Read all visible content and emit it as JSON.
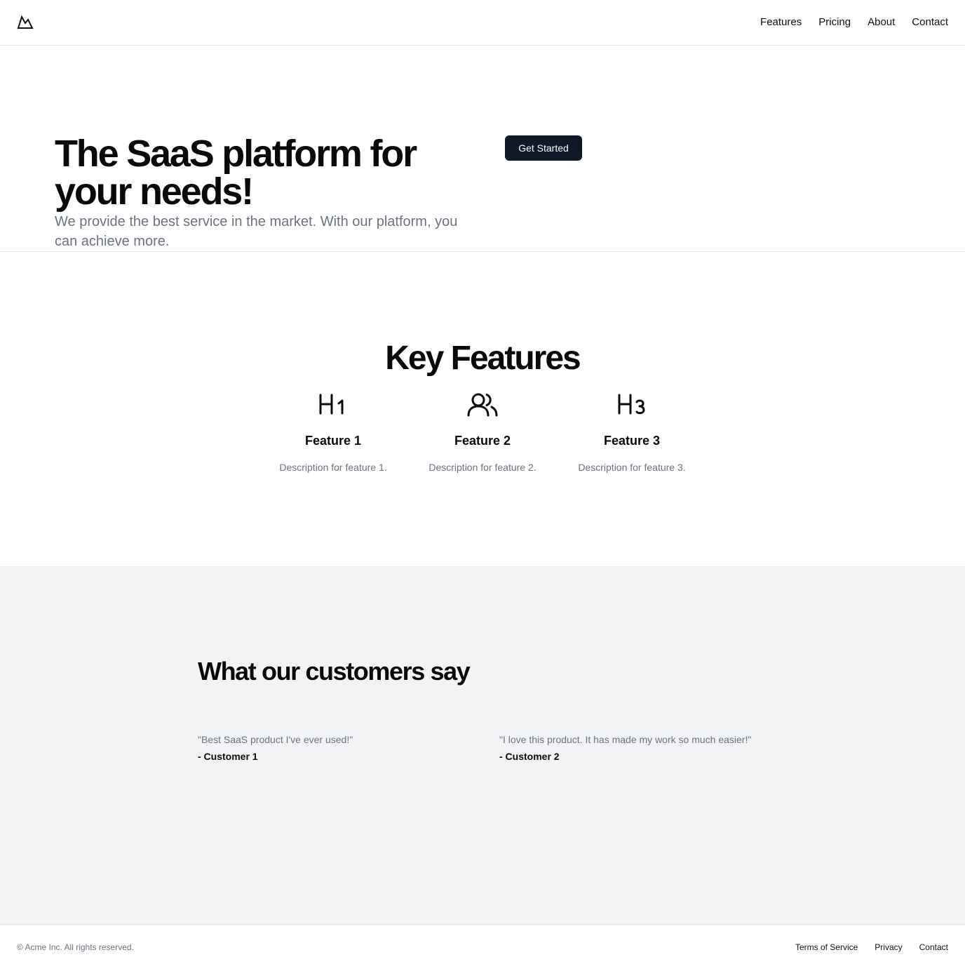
{
  "header": {
    "logo_icon": "mountain-icon",
    "nav": [
      "Features",
      "Pricing",
      "About",
      "Contact"
    ]
  },
  "hero": {
    "title": "The SaaS platform for your needs!",
    "subtitle": "We provide the best service in the market. With our platform, you can achieve more.",
    "cta_label": "Get Started",
    "cta_color": "#111827"
  },
  "features": {
    "title": "Key Features",
    "items": [
      {
        "icon": "heading-1-icon",
        "title": "Feature 1",
        "description": "Description for feature 1."
      },
      {
        "icon": "users-icon",
        "title": "Feature 2",
        "description": "Description for feature 2."
      },
      {
        "icon": "heading-3-icon",
        "title": "Feature 3",
        "description": "Description for feature 3."
      }
    ]
  },
  "testimonials": {
    "title": "What our customers say",
    "items": [
      {
        "quote": "\"Best SaaS product I've ever used!\"",
        "author": "- Customer 1"
      },
      {
        "quote": "\"I love this product. It has made my work so much easier!\"",
        "author": "- Customer 2"
      }
    ]
  },
  "footer": {
    "copyright": "© Acme Inc. All rights reserved.",
    "links": [
      "Terms of Service",
      "Privacy",
      "Contact"
    ]
  },
  "colors": {
    "muted_text": "#6b7280",
    "section_bg": "#f2f3f5",
    "border": "#e5e7eb"
  }
}
